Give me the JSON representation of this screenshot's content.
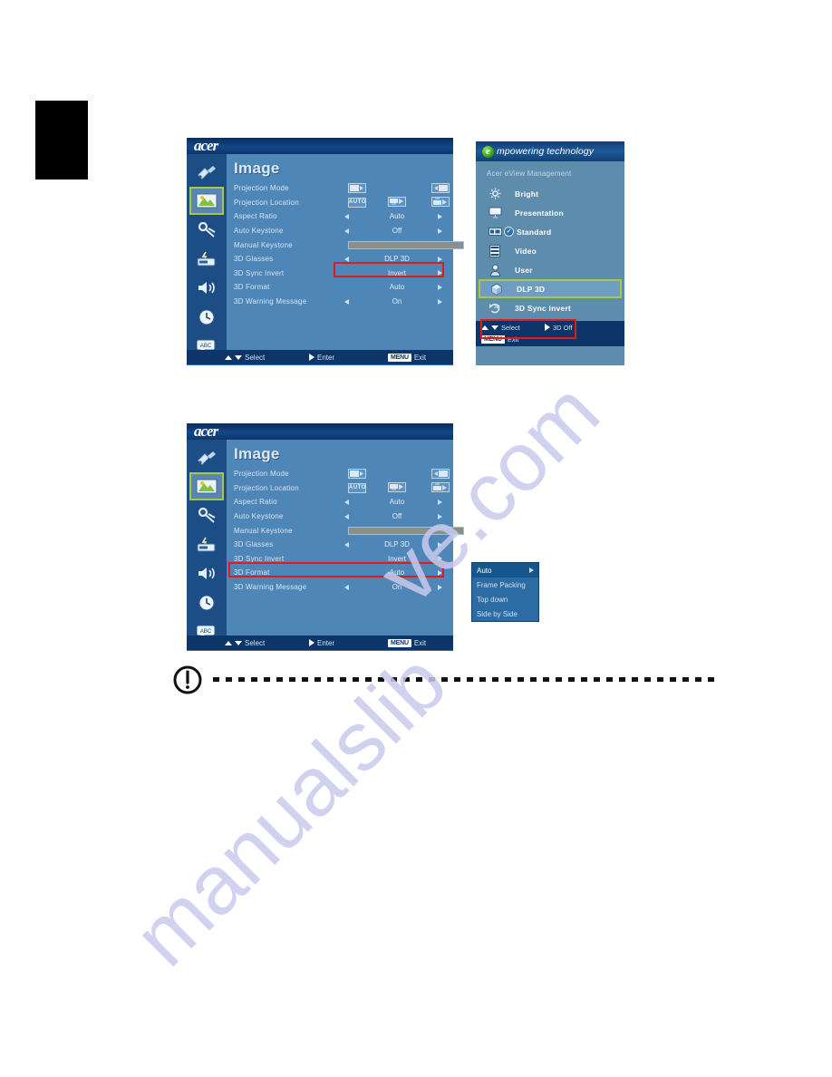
{
  "page": {
    "watermark_1": "ve.com",
    "watermark_2": "manualslib"
  },
  "osd_top": {
    "brand": "acer",
    "title": "Image",
    "sidebar": [
      {
        "name": "color-settings-icon",
        "label": "Color"
      },
      {
        "name": "image-icon",
        "label": "Image"
      },
      {
        "name": "setting-icon",
        "label": "Setting"
      },
      {
        "name": "management-icon",
        "label": "Management"
      },
      {
        "name": "audio-icon",
        "label": "Audio"
      },
      {
        "name": "timer-icon",
        "label": "Timer"
      },
      {
        "name": "language-icon",
        "label": "Language"
      }
    ],
    "rows": [
      {
        "label": "Projection Mode",
        "value": "",
        "type": "icons2"
      },
      {
        "label": "Projection Location",
        "value": "",
        "type": "icons3"
      },
      {
        "label": "Aspect Ratio",
        "value": "Auto",
        "type": "arrows"
      },
      {
        "label": "Auto Keystone",
        "value": "Off",
        "type": "arrows"
      },
      {
        "label": "Manual Keystone",
        "value": "0",
        "type": "slider"
      },
      {
        "label": "3D Glasses",
        "value": "DLP 3D",
        "type": "arrows"
      },
      {
        "label": "3D Sync Invert",
        "value": "Invert",
        "type": "arrows-right"
      },
      {
        "label": "3D Format",
        "value": "Auto",
        "type": "arrows-right"
      },
      {
        "label": "3D Warning Message",
        "value": "On",
        "type": "arrows"
      }
    ],
    "footer": {
      "select": "Select",
      "enter": "Enter",
      "menu_key": "MENU",
      "exit": "Exit"
    },
    "highlight_row_label": "3D Sync Invert",
    "highlight_color": "#e01b18",
    "selected_sidebar_index": 1,
    "selected_border_color": "#a9c73f"
  },
  "osd_bottom": {
    "brand": "acer",
    "title": "Image",
    "rows": [
      {
        "label": "Projection Mode",
        "value": "",
        "type": "icons2"
      },
      {
        "label": "Projection Location",
        "value": "",
        "type": "icons3"
      },
      {
        "label": "Aspect Ratio",
        "value": "Auto",
        "type": "arrows"
      },
      {
        "label": "Auto Keystone",
        "value": "Off",
        "type": "arrows"
      },
      {
        "label": "Manual Keystone",
        "value": "0",
        "type": "slider"
      },
      {
        "label": "3D Glasses",
        "value": "DLP 3D",
        "type": "arrows"
      },
      {
        "label": "3D Sync Invert",
        "value": "Invert",
        "type": "arrows-right"
      },
      {
        "label": "3D Format",
        "value": "Auto",
        "type": "arrows-right"
      },
      {
        "label": "3D Warning Message",
        "value": "On",
        "type": "arrows"
      }
    ],
    "footer": {
      "select": "Select",
      "enter": "Enter",
      "menu_key": "MENU",
      "exit": "Exit"
    },
    "highlight_row_label": "3D Format"
  },
  "empowering": {
    "brand_e": "e",
    "brand_text": "mpowering technology",
    "subtitle": "Acer eView Management",
    "items": [
      {
        "label": "Bright",
        "icon": "brightness-icon",
        "checked": false,
        "selected": false,
        "highlighted": false
      },
      {
        "label": "Presentation",
        "icon": "presentation-screen-icon",
        "checked": false,
        "selected": false,
        "highlighted": false
      },
      {
        "label": "Standard",
        "icon": "standard-display-icon",
        "checked": true,
        "selected": false,
        "highlighted": false
      },
      {
        "label": "Video",
        "icon": "video-film-icon",
        "checked": false,
        "selected": false,
        "highlighted": false
      },
      {
        "label": "User",
        "icon": "user-icon",
        "checked": false,
        "selected": false,
        "highlighted": false
      },
      {
        "label": "DLP 3D",
        "icon": "cube-3d-icon",
        "checked": false,
        "selected": true,
        "highlighted": false
      },
      {
        "label": "3D Sync Invert",
        "icon": "sync-invert-icon",
        "checked": false,
        "selected": false,
        "highlighted": true
      }
    ],
    "footer": {
      "select": "Select",
      "mode": "3D Off",
      "menu_key": "MENU",
      "exit": "Exit"
    }
  },
  "dropdown": {
    "items": [
      {
        "label": "Auto",
        "selected": true,
        "has_arrow": true
      },
      {
        "label": "Frame Packing",
        "selected": false,
        "has_arrow": false
      },
      {
        "label": "Top down",
        "selected": false,
        "has_arrow": false
      },
      {
        "label": "Side by Side",
        "selected": false,
        "has_arrow": false
      }
    ]
  },
  "note": {
    "icon": "exclamation-note-icon"
  }
}
